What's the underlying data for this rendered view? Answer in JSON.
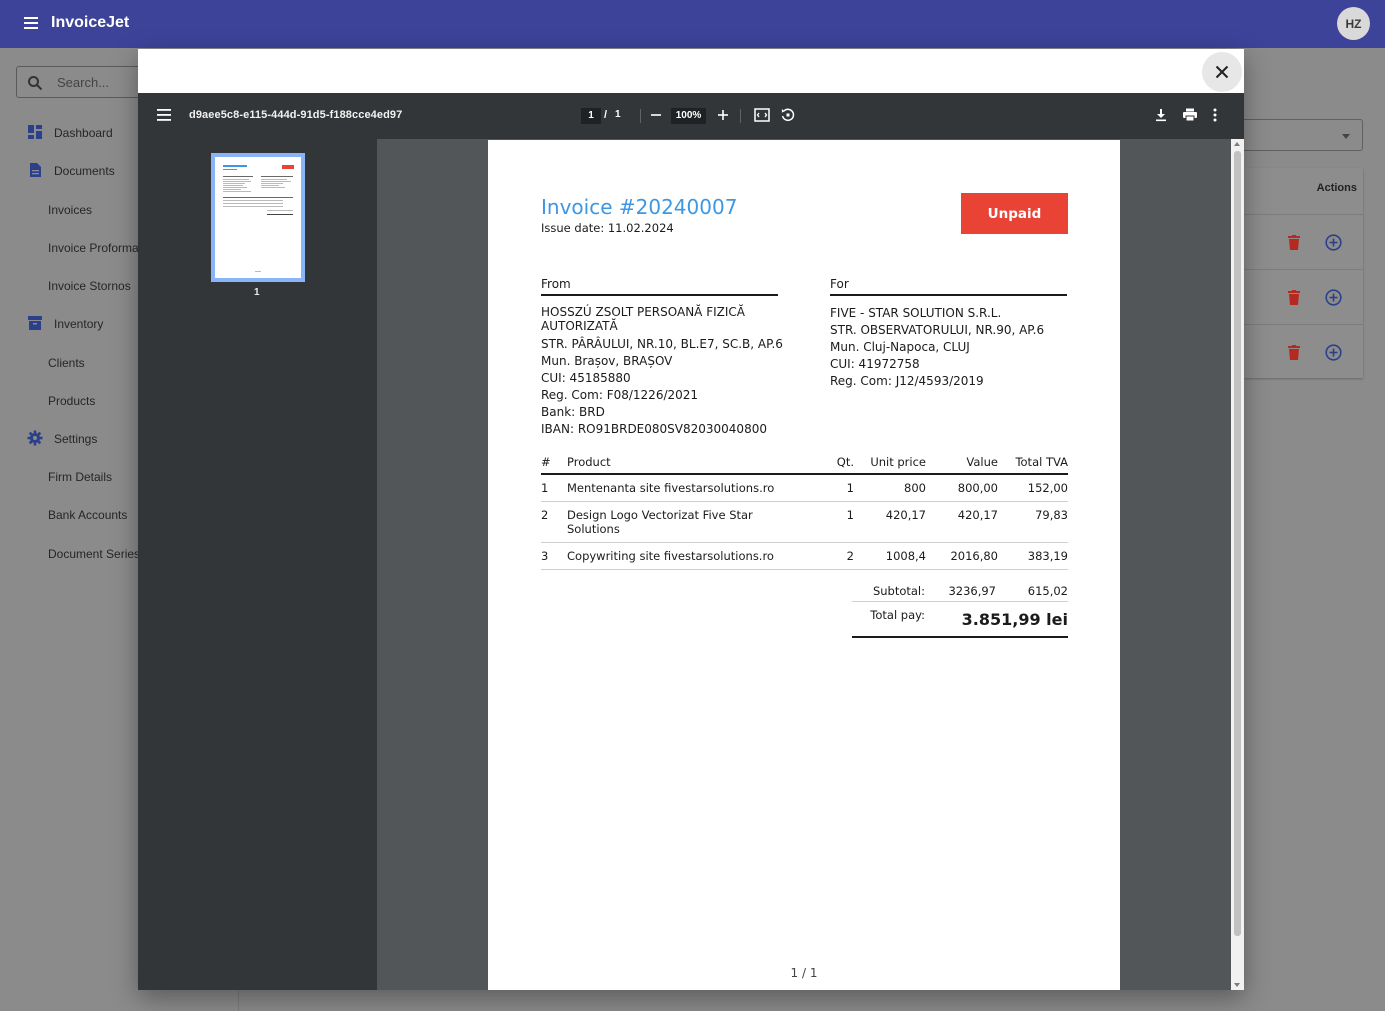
{
  "app": {
    "title": "InvoiceJet",
    "avatar_initials": "HZ",
    "brand_color": "#3d4399"
  },
  "search": {
    "placeholder": "Search..."
  },
  "sidebar": {
    "items": [
      {
        "label": "Dashboard",
        "icon": "dashboard-icon",
        "level": "top"
      },
      {
        "label": "Documents",
        "icon": "document-icon",
        "level": "top"
      },
      {
        "label": "Invoices",
        "level": "sub"
      },
      {
        "label": "Invoice Proformas",
        "level": "sub"
      },
      {
        "label": "Invoice Stornos",
        "level": "sub"
      },
      {
        "label": "Inventory",
        "icon": "inventory-icon",
        "level": "top"
      },
      {
        "label": "Clients",
        "level": "sub"
      },
      {
        "label": "Products",
        "level": "sub"
      },
      {
        "label": "Settings",
        "icon": "gear-icon",
        "level": "top"
      },
      {
        "label": "Firm Details",
        "level": "sub"
      },
      {
        "label": "Bank Accounts",
        "level": "sub"
      },
      {
        "label": "Document Series",
        "level": "sub"
      }
    ]
  },
  "table": {
    "actions_header": "Actions",
    "row_count": 3
  },
  "viewer": {
    "filename": "d9aee5c8-e115-444d-91d5-f188cce4ed97",
    "current_page": "1",
    "page_separator": "/",
    "total_pages": "1",
    "zoom": "100%",
    "thumbnail_label": "1",
    "page_footer": "1 / 1"
  },
  "invoice": {
    "title": "Invoice #20240007",
    "issue_date_label": "Issue date:",
    "issue_date": "11.02.2024",
    "status": "Unpaid",
    "status_color": "#e84335",
    "title_color": "#3e97e3",
    "from": {
      "heading": "From",
      "name": "HOSSZÚ ZSOLT PERSOANĂ FIZICĂ AUTORIZATĂ",
      "lines": [
        "STR. PÂRÂULUI, NR.10, BL.E7, SC.B, AP.6",
        "Mun. Brașov, BRAȘOV",
        "CUI: 45185880",
        "Reg. Com: F08/1226/2021",
        "Bank: BRD",
        "IBAN: RO91BRDE080SV82030040800"
      ]
    },
    "for": {
      "heading": "For",
      "lines": [
        "FIVE - STAR SOLUTION S.R.L.",
        "STR. OBSERVATORULUI, NR.90, AP.6",
        "Mun. Cluj-Napoca, CLUJ",
        "CUI: 41972758",
        "Reg. Com: J12/4593/2019"
      ]
    },
    "columns": [
      "#",
      "Product",
      "Qt.",
      "Unit price",
      "Value",
      "Total TVA"
    ],
    "rows": [
      [
        "1",
        "Mentenanta site fivestarsolutions.ro",
        "1",
        "800",
        "800,00",
        "152,00"
      ],
      [
        "2",
        "Design Logo Vectorizat Five Star Solutions",
        "1",
        "420,17",
        "420,17",
        "79,83"
      ],
      [
        "3",
        "Copywriting site fivestarsolutions.ro",
        "2",
        "1008,4",
        "2016,80",
        "383,19"
      ]
    ],
    "subtotal_label": "Subtotal:",
    "subtotal_value": "3236,97",
    "subtotal_tva": "615,02",
    "total_label": "Total pay:",
    "total_value": "3.851,99 lei"
  }
}
